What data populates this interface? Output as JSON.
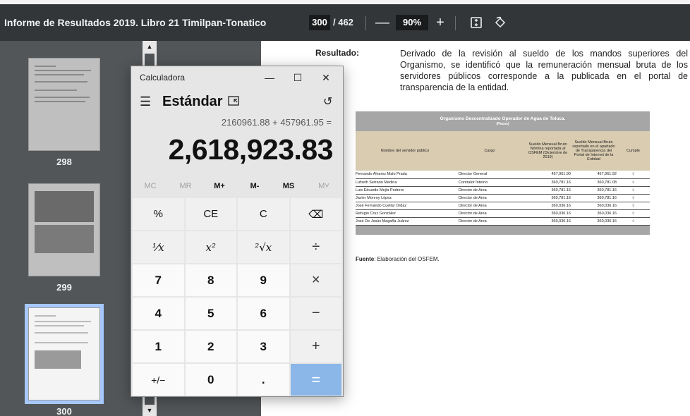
{
  "toolbar": {
    "doc_title": "Informe de Resultados 2019. Libro 21 Timilpan-Tonatico",
    "page_current": "300",
    "page_total": "/ 462",
    "zoom_out": "—",
    "zoom": "90%",
    "zoom_in": "+"
  },
  "sidebar": {
    "thumbnails": [
      {
        "label": "298"
      },
      {
        "label": "299"
      },
      {
        "label": "300"
      }
    ]
  },
  "page": {
    "result_label": "Resultado:",
    "result_text": "Derivado de la revisión al sueldo de los mandos superiores del Organismo, se identificó que la remuneración mensual bruta de los servidores públicos corresponde a la publicada en el portal de transparencia de la entidad.",
    "table": {
      "title": "Organismo Descentralizado Operador de Agua de Toluca.",
      "subtitle": "(Pesos)",
      "headers": [
        "Nombre del servidor público",
        "Cargo",
        "Sueldo Mensual Bruto Nómina reportada al OSFEM (Diciembre de 2019)",
        "Sueldo Mensual Bruto reportado en el apartado de Transparencia del Portal de Internet de la Entidad",
        "Cumple"
      ],
      "rows": [
        [
          "Fernando Alvarez Malo Prada",
          "Director General",
          "457,961.90",
          "457,961.92",
          "√"
        ],
        [
          "Lizbeth Serrano Medina",
          "Contralor Interno",
          "360,781.16",
          "360,781.08",
          "√"
        ],
        [
          "Luis Eduardo Mejía Pedrero",
          "Director de Area",
          "360,781.16",
          "360,781.16",
          "√"
        ],
        [
          "Javier Monroy López",
          "Director de Area",
          "360,781.16",
          "360,781.16",
          "√"
        ],
        [
          "José Fernando Cuellar Ordaz",
          "Director de Area",
          "360,036.16",
          "360,036.16",
          "√"
        ],
        [
          "Refugio Cruz González",
          "Director de Area",
          "360,036.16",
          "360,036.16",
          "√"
        ],
        [
          "José De Jesús Magaña Juárez",
          "Director de Area",
          "360,036.16",
          "360,036.16",
          "√"
        ]
      ]
    },
    "source_label": "Fuente",
    "source_text": ": Elaboración del OSFEM."
  },
  "calculator": {
    "title": "Calculadora",
    "mode": "Estándar",
    "expression": "2160961.88 + 457961.95 =",
    "result": "2,618,923.83",
    "memory": [
      "MC",
      "MR",
      "M+",
      "M-",
      "MS",
      "M˅"
    ],
    "keys": [
      [
        "%",
        "CE",
        "C",
        "⌫"
      ],
      [
        "¹⁄x",
        "x²",
        "²√x",
        "÷"
      ],
      [
        "7",
        "8",
        "9",
        "×"
      ],
      [
        "4",
        "5",
        "6",
        "−"
      ],
      [
        "1",
        "2",
        "3",
        "+"
      ],
      [
        "+/−",
        "0",
        ".",
        "="
      ]
    ]
  }
}
